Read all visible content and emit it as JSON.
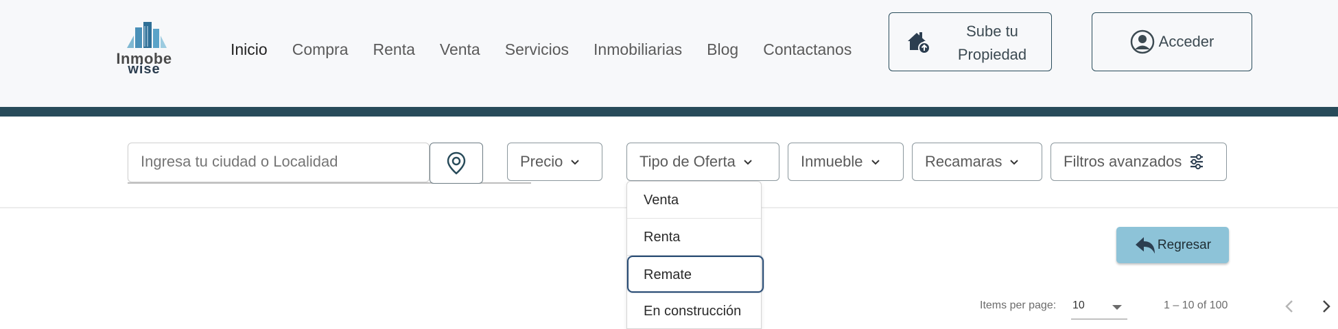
{
  "header": {
    "logo": {
      "text_main": "Inmobe",
      "text_accent": "be",
      "text_sub": "wise",
      "icon": "buildings-logo-icon"
    },
    "nav": [
      {
        "label": "Inicio",
        "active": true
      },
      {
        "label": "Compra"
      },
      {
        "label": "Renta"
      },
      {
        "label": "Venta"
      },
      {
        "label": "Servicios"
      },
      {
        "label": "Inmobiliarias"
      },
      {
        "label": "Blog"
      },
      {
        "label": "Contactanos"
      }
    ],
    "sube_button": {
      "line1": "Sube tu",
      "line2": "Propiedad",
      "icon": "house-upload-icon"
    },
    "acceder_button": {
      "label": "Acceder",
      "icon": "user-circle-icon"
    }
  },
  "filters": {
    "search_placeholder": "Ingresa tu ciudad o Localidad",
    "location_icon": "location-pin-icon",
    "precio": "Precio",
    "tipo_oferta": "Tipo de Oferta",
    "inmueble": "Inmueble",
    "recamaras": "Recamaras",
    "avanzados": "Filtros avanzados",
    "avanzados_icon": "sliders-icon"
  },
  "dropdown": {
    "items": [
      "Venta",
      "Renta",
      "Remate",
      "En construcción"
    ],
    "selected": "Remate"
  },
  "regresar": {
    "label": "Regresar",
    "icon": "back-arrow-icon"
  },
  "paginator": {
    "items_label": "Items per page:",
    "page_size": "10",
    "range": "1 – 10 of 100"
  },
  "colors": {
    "header_bg": "#f7f8fa",
    "accent_dark": "#284b5a",
    "regresar_bg": "#8dc3d8",
    "selected_border": "#284b74"
  }
}
